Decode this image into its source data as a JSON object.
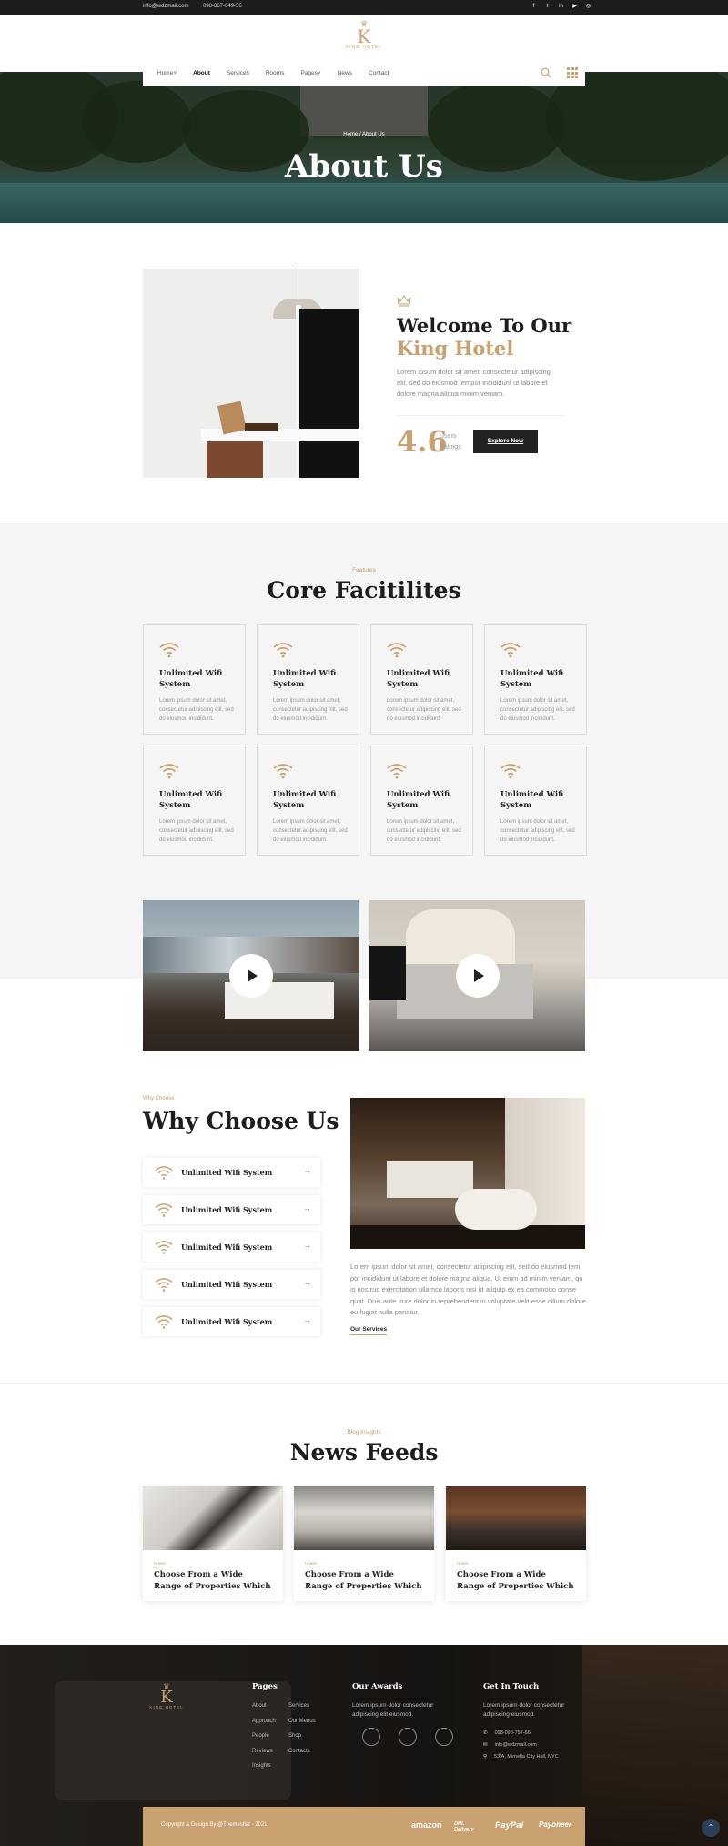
{
  "topbar": {
    "email": "info@wdzmail.com",
    "phone": "098-867-649-56",
    "socials": [
      "f",
      "t",
      "in",
      "yt",
      "ig"
    ]
  },
  "logo": {
    "letter": "K",
    "name": "KING HOTEL"
  },
  "nav": {
    "items": [
      {
        "label": "Home",
        "has_dropdown": true
      },
      {
        "label": "About",
        "active": true
      },
      {
        "label": "Services"
      },
      {
        "label": "Rooms"
      },
      {
        "label": "Pages",
        "has_dropdown": true
      },
      {
        "label": "News"
      },
      {
        "label": "Contact"
      }
    ]
  },
  "hero": {
    "breadcrumb_home": "Home",
    "breadcrumb_sep": "/",
    "breadcrumb_current": "About Us",
    "title": "About Us"
  },
  "welcome": {
    "title_line1": "Welcome To Our",
    "title_line2": "King Hotel",
    "text": "Lorem ipsum dolor sit amet, consectetur adipiscing elit, sed do eiusmod tempor incididunt ut labore et dolore magna aliqua minim veniam.",
    "rating": "4.6",
    "rating_label_1": "Users",
    "rating_label_2": "Ratings",
    "button": "Explore Now"
  },
  "facilities": {
    "eyebrow": "Features",
    "title": "Core Facitilites",
    "cards": [
      {
        "title": "Unlimited Wifi System",
        "desc": "Lorem ipsum dolor sit amet, consectetur adipiscing elit, sed do eiusmod incididunt."
      },
      {
        "title": "Unlimited Wifi System",
        "desc": "Lorem ipsum dolor sit amet, consectetur adipiscing elit, sed do eiusmod incididunt."
      },
      {
        "title": "Unlimited Wifi System",
        "desc": "Lorem ipsum dolor sit amet, consectetur adipiscing elit, sed do eiusmod incididunt."
      },
      {
        "title": "Unlimited Wifi System",
        "desc": "Lorem ipsum dolor sit amet, consectetur adipiscing elit, sed do eiusmod incididunt."
      },
      {
        "title": "Unlimited Wifi System",
        "desc": "Lorem ipsum dolor sit amet, consectetur adipiscing elit, sed do eiusmod incididunt."
      },
      {
        "title": "Unlimited Wifi System",
        "desc": "Lorem ipsum dolor sit amet, consectetur adipiscing elit, sed do eiusmod incididunt."
      },
      {
        "title": "Unlimited Wifi System",
        "desc": "Lorem ipsum dolor sit amet, consectetur adipiscing elit, sed do eiusmod incididunt."
      },
      {
        "title": "Unlimited Wifi System",
        "desc": "Lorem ipsum dolor sit amet, consectetur adipiscing elit, sed do eiusmod incididunt."
      }
    ]
  },
  "why": {
    "eyebrow": "Why Choose",
    "title": "Why Choose Us",
    "items": [
      "Unlimited Wifi System",
      "Unlimited Wifi System",
      "Unlimited Wifi System",
      "Unlimited Wifi System",
      "Unlimited Wifi System"
    ],
    "text": "Lorem ipsum dolor sit amet, consectetur adipiscing elit, sed do eiusmod tem por incididunt ut labore et dolore magna aliqua. Ut enim ad minim veniam, qu is nostrud exercitation ullamco laboris nisi ut aliquip ex ea commodo conse quat. Duis aute irure dolor in reprehenderit in voluptate velit esse cillum dolore eu fugiat nulla pariatur.",
    "link": "Our Services"
  },
  "news": {
    "eyebrow": "Blog Insights",
    "title": "News Feeds",
    "posts": [
      {
        "tag": "Hotels",
        "title": "Choose From a Wide Range of Properties Which"
      },
      {
        "tag": "Hotels",
        "title": "Choose From a Wide Range of Properties Which"
      },
      {
        "tag": "Hotels",
        "title": "Choose From a Wide Range of Properties Which"
      }
    ]
  },
  "footer": {
    "logo_letter": "K",
    "logo_name": "KING HOTEL",
    "pages_heading": "Pages",
    "pages_col1": [
      "About",
      "Approach",
      "People",
      "Reviews",
      "Insights"
    ],
    "pages_col2": [
      "Services",
      "Our Menus",
      "Shop",
      "Contacts"
    ],
    "awards_heading": "Our Awards",
    "awards_text": "Lorem ipsum dolor consectetur adipiscing elit eiusmod.",
    "contact_heading": "Get In Touch",
    "contact_text": "Lorem ipsum dolor consectetur adipiscing eiusmod.",
    "phone": "098-098-757-66",
    "email": "info@wdzmail.com",
    "address": "53/A, Mirnelta City Hall, NYC",
    "copyright": "Copyright & Design By @Themesflat - 2021",
    "brands": [
      "amazon",
      "DHL Delivery",
      "PayPal",
      "Payoneer"
    ]
  }
}
